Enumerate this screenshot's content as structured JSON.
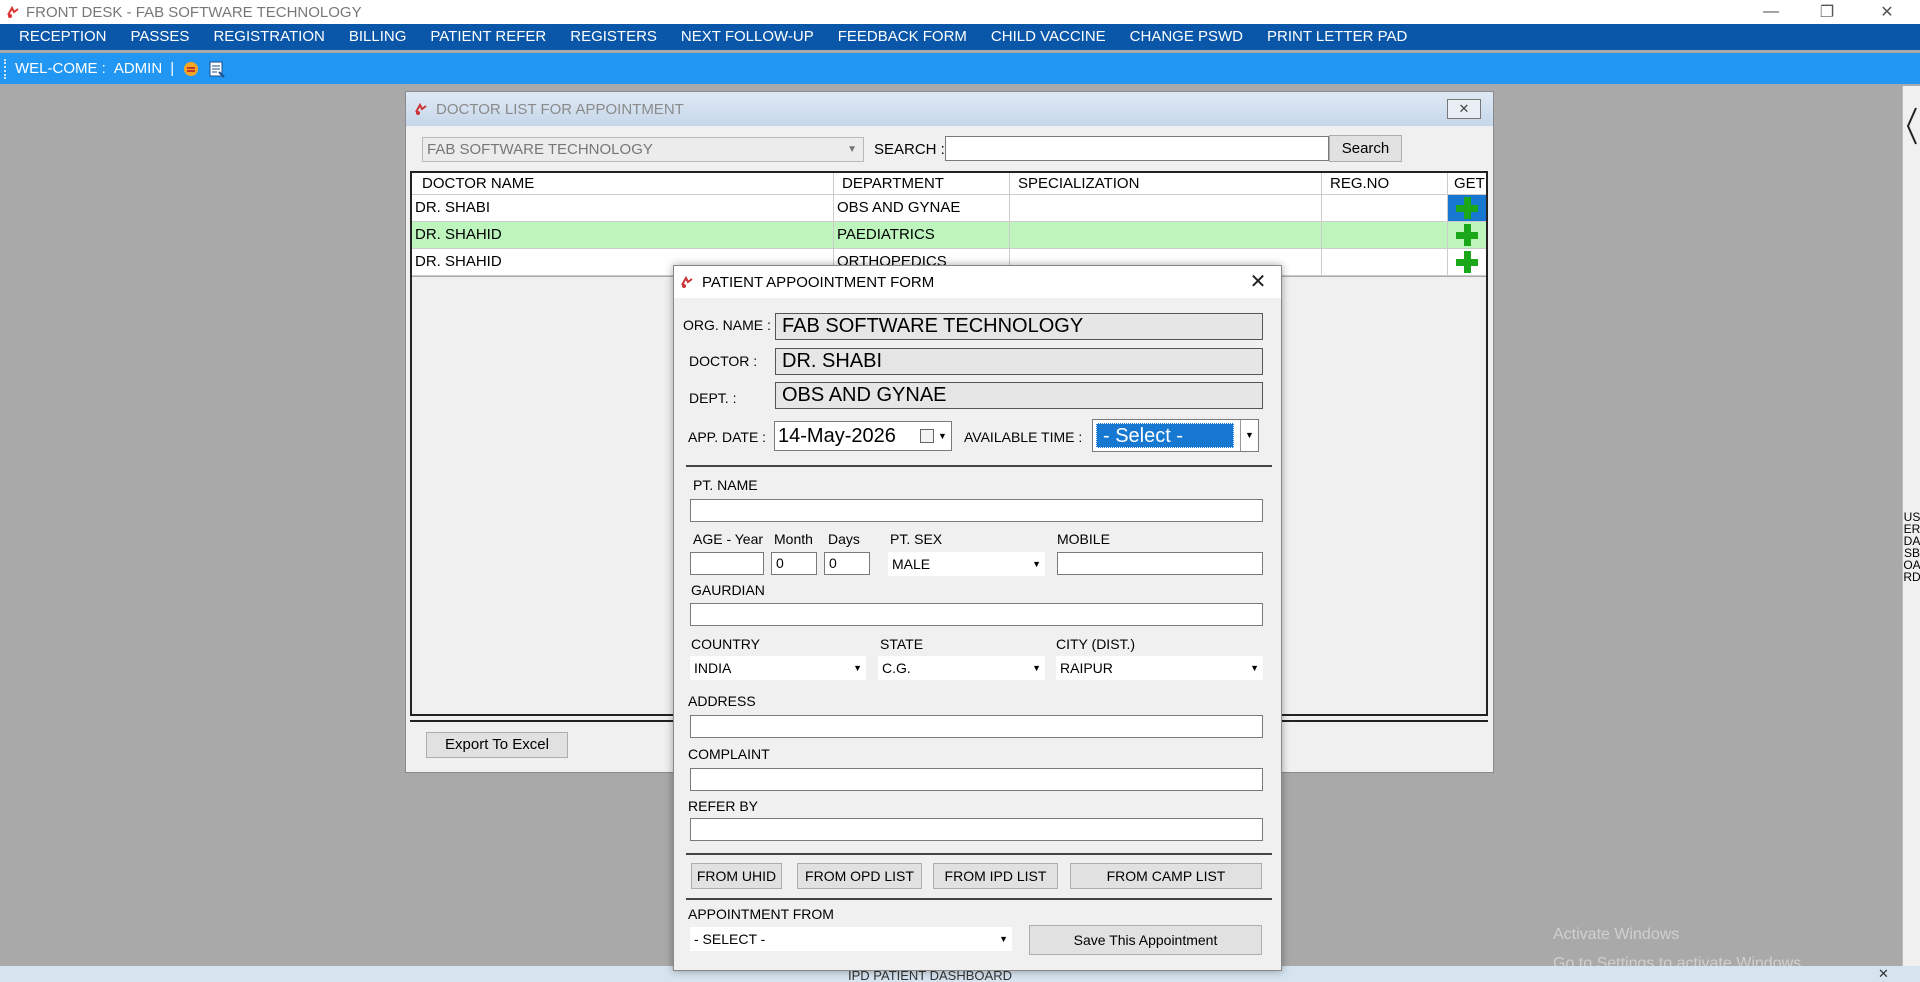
{
  "window": {
    "title": "FRONT DESK - FAB SOFTWARE TECHNOLOGY",
    "minimize": "—",
    "restore": "❐",
    "close": "✕"
  },
  "menu": [
    "RECEPTION",
    "PASSES",
    "REGISTRATION",
    "BILLING",
    "PATIENT REFER",
    "REGISTERS",
    "NEXT FOLLOW-UP",
    "FEEDBACK FORM",
    "CHILD VACCINE",
    "CHANGE PSWD",
    "PRINT LETTER PAD"
  ],
  "welcome": {
    "label": "WEL-COME :",
    "user": "ADMIN",
    "separator": "|"
  },
  "right_strip": {
    "text": "USER DASBOARD"
  },
  "bottom_strip": {
    "text": "IPD PATIENT DASHBOARD",
    "close": "✕"
  },
  "watermark": {
    "line1": "Activate Windows",
    "line2": "Go to Settings to activate Windows."
  },
  "doctor_list": {
    "title": "DOCTOR LIST FOR APPOINTMENT",
    "close": "✕",
    "org_value": "FAB SOFTWARE TECHNOLOGY",
    "search_label": "SEARCH :",
    "search_value": "",
    "search_button": "Search",
    "columns": [
      "DOCTOR NAME",
      "DEPARTMENT",
      "SPECIALIZATION",
      "REG.NO",
      "GET"
    ],
    "rows": [
      {
        "doctor": "DR. SHABI",
        "department": "OBS AND GYNAE",
        "specialization": "",
        "reg_no": ""
      },
      {
        "doctor": "DR. SHAHID",
        "department": "PAEDIATRICS",
        "specialization": "",
        "reg_no": ""
      },
      {
        "doctor": "DR. SHAHID",
        "department": "ORTHOPEDICS",
        "specialization": "",
        "reg_no": ""
      }
    ],
    "export_button": "Export To Excel"
  },
  "appointment_form": {
    "title": "PATIENT APPOOINTMENT FORM",
    "close": "✕",
    "org_label": "ORG. NAME :",
    "org_value": "FAB SOFTWARE TECHNOLOGY",
    "doctor_label": "DOCTOR :",
    "doctor_value": "DR. SHABI",
    "dept_label": "DEPT. :",
    "dept_value": "OBS AND GYNAE",
    "date_label": "APP. DATE :",
    "date_value": "14-May-2026",
    "time_label": "AVAILABLE TIME :",
    "time_value": "- Select -",
    "pt_name_label": "PT. NAME",
    "pt_name_value": "",
    "age_year_label": "AGE - Year",
    "age_year_value": "",
    "month_label": "Month",
    "month_value": "0",
    "days_label": "Days",
    "days_value": "0",
    "sex_label": "PT. SEX",
    "sex_value": "MALE",
    "mobile_label": "MOBILE",
    "mobile_value": "",
    "guardian_label": "GAURDIAN",
    "guardian_value": "",
    "country_label": "COUNTRY",
    "country_value": "INDIA",
    "state_label": "STATE",
    "state_value": "C.G.",
    "city_label": "CITY (DIST.)",
    "city_value": "RAIPUR",
    "address_label": "ADDRESS",
    "address_value": "",
    "complaint_label": "COMPLAINT",
    "complaint_value": "",
    "refer_label": "REFER BY",
    "refer_value": "",
    "from_uhid": "FROM UHID",
    "from_opd": "FROM OPD LIST",
    "from_ipd": "FROM IPD LIST",
    "from_camp": "FROM CAMP LIST",
    "appt_from_label": "APPOINTMENT FROM",
    "appt_from_value": "- SELECT -",
    "save_button": "Save This Appointment"
  },
  "colors": {
    "menu_bar": "#0a56a8",
    "welcome_bar": "#2196f3",
    "selected_row": "#bdf5bd",
    "selection_blue": "#1778d2",
    "plus_green": "#1aa81a"
  }
}
